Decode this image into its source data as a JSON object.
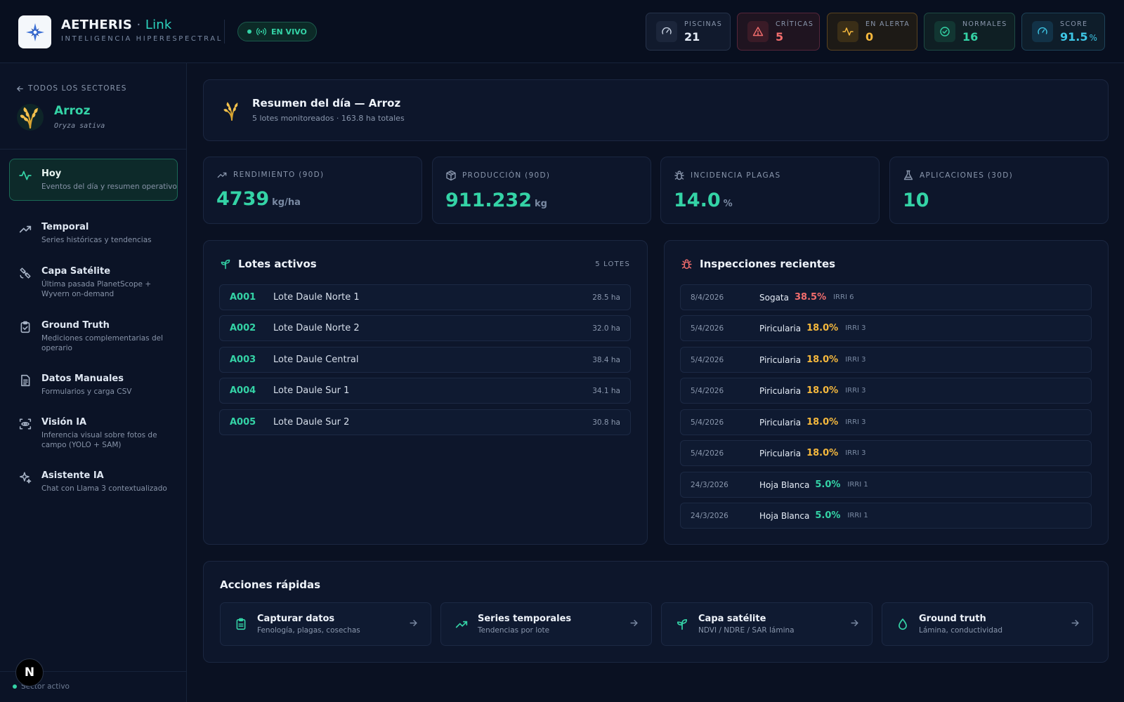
{
  "header": {
    "brand_name": "AETHERIS",
    "brand_sep": "·",
    "brand_suffix": "Link",
    "brand_subtitle": "INTELIGENCIA HIPERESPECTRAL",
    "live_label": "EN VIVO",
    "stats": [
      {
        "label": "PISCINAS",
        "value": "21",
        "icon": "gauge-icon",
        "color": "#e6edf7"
      },
      {
        "label": "CRÍTICAS",
        "value": "5",
        "icon": "warning-triangle-icon",
        "color": "#f26d6d"
      },
      {
        "label": "EN ALERTA",
        "value": "0",
        "icon": "pulse-icon",
        "color": "#f5b83d"
      },
      {
        "label": "NORMALES",
        "value": "16",
        "icon": "check-circle-icon",
        "color": "#34d3a6"
      },
      {
        "label": "SCORE",
        "value": "91.5",
        "unit": "%",
        "icon": "gauge-icon",
        "color": "#3ec7e6"
      }
    ]
  },
  "sidebar": {
    "back_label": "TODOS LOS SECTORES",
    "crop_name": "Arroz",
    "crop_scientific": "Oryza sativa",
    "items": [
      {
        "title": "Hoy",
        "desc": "Eventos del día y resumen operativo",
        "icon": "pulse-icon",
        "active": true
      },
      {
        "title": "Temporal",
        "desc": "Series históricas y tendencias",
        "icon": "trend-up-icon"
      },
      {
        "title": "Capa Satélite",
        "desc": "Última pasada PlanetScope + Wyvern on-demand",
        "icon": "satellite-icon"
      },
      {
        "title": "Ground Truth",
        "desc": "Mediciones complementarias del operario",
        "icon": "clipboard-check-icon"
      },
      {
        "title": "Datos Manuales",
        "desc": "Formularios y carga CSV",
        "icon": "document-icon"
      },
      {
        "title": "Visión IA",
        "desc": "Inferencia visual sobre fotos de campo (YOLO + SAM)",
        "icon": "scan-eye-icon"
      },
      {
        "title": "Asistente IA",
        "desc": "Chat con Llama 3 contextualizado",
        "icon": "sparkles-icon"
      }
    ],
    "footer_label": "Sector activo",
    "badge_letter": "N"
  },
  "summary": {
    "title": "Resumen del día — Arroz",
    "subtitle": "5 lotes monitoreados · 163.8 ha totales"
  },
  "kpis": [
    {
      "label": "RENDIMIENTO (90D)",
      "value": "4739",
      "unit": "kg/ha",
      "icon": "trend-up-icon"
    },
    {
      "label": "PRODUCCIÓN (90D)",
      "value": "911.232",
      "unit": "kg",
      "icon": "package-icon"
    },
    {
      "label": "INCIDENCIA PLAGAS",
      "value": "14.0",
      "unit": "%",
      "icon": "bug-icon"
    },
    {
      "label": "APLICACIONES (30D)",
      "value": "10",
      "unit": "",
      "icon": "flask-icon"
    }
  ],
  "lots": {
    "title": "Lotes activos",
    "count_label": "5 LOTES",
    "rows": [
      {
        "code": "A001",
        "name": "Lote Daule Norte 1",
        "area": "28.5 ha"
      },
      {
        "code": "A002",
        "name": "Lote Daule Norte 2",
        "area": "32.0 ha"
      },
      {
        "code": "A003",
        "name": "Lote Daule Central",
        "area": "38.4 ha"
      },
      {
        "code": "A004",
        "name": "Lote Daule Sur 1",
        "area": "34.1 ha"
      },
      {
        "code": "A005",
        "name": "Lote Daule Sur 2",
        "area": "30.8 ha"
      }
    ]
  },
  "inspections": {
    "title": "Inspecciones recientes",
    "rows": [
      {
        "date": "8/4/2026",
        "pest": "Sogata",
        "pct": "38.5%",
        "irri": "IRRI 6",
        "color": "#f26d6d"
      },
      {
        "date": "5/4/2026",
        "pest": "Piricularia",
        "pct": "18.0%",
        "irri": "IRRI 3",
        "color": "#f5b83d"
      },
      {
        "date": "5/4/2026",
        "pest": "Piricularia",
        "pct": "18.0%",
        "irri": "IRRI 3",
        "color": "#f5b83d"
      },
      {
        "date": "5/4/2026",
        "pest": "Piricularia",
        "pct": "18.0%",
        "irri": "IRRI 3",
        "color": "#f5b83d"
      },
      {
        "date": "5/4/2026",
        "pest": "Piricularia",
        "pct": "18.0%",
        "irri": "IRRI 3",
        "color": "#f5b83d"
      },
      {
        "date": "5/4/2026",
        "pest": "Piricularia",
        "pct": "18.0%",
        "irri": "IRRI 3",
        "color": "#f5b83d"
      },
      {
        "date": "24/3/2026",
        "pest": "Hoja Blanca",
        "pct": "5.0%",
        "irri": "IRRI 1",
        "color": "#34d3a6"
      },
      {
        "date": "24/3/2026",
        "pest": "Hoja Blanca",
        "pct": "5.0%",
        "irri": "IRRI 1",
        "color": "#34d3a6"
      }
    ]
  },
  "quick_actions": {
    "title": "Acciones rápidas",
    "items": [
      {
        "title": "Capturar datos",
        "sub": "Fenología, plagas, cosechas",
        "icon": "clipboard-icon"
      },
      {
        "title": "Series temporales",
        "sub": "Tendencias por lote",
        "icon": "trend-up-icon"
      },
      {
        "title": "Capa satélite",
        "sub": "NDVI / NDRE / SAR lámina",
        "icon": "sprout-icon"
      },
      {
        "title": "Ground truth",
        "sub": "Lámina, conductividad",
        "icon": "droplet-icon"
      }
    ]
  }
}
